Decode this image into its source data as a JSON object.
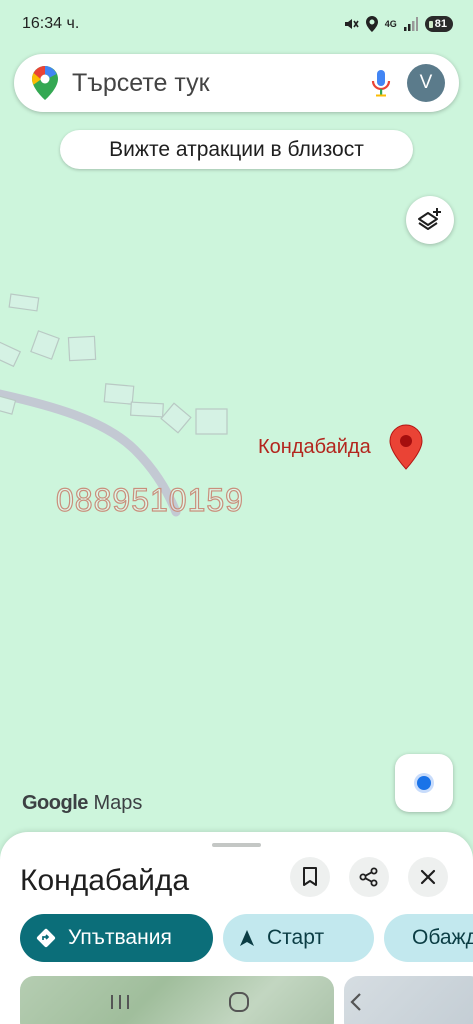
{
  "status_bar": {
    "time": "16:34 ч.",
    "network": "4G",
    "battery": "81"
  },
  "search": {
    "placeholder": "Търсете тук",
    "avatar_letter": "V"
  },
  "chips": {
    "attractions": "Вижте атракции в близост"
  },
  "map": {
    "place_label": "Кондабайда",
    "watermark": "0889510159",
    "logo_google": "Google",
    "logo_maps": "Maps"
  },
  "sheet": {
    "title": "Кондабайда",
    "actions": {
      "directions": "Упътвания",
      "start": "Старт",
      "call": "Обаждане"
    }
  },
  "colors": {
    "map_bg": "#cdf5dc",
    "accent": "#0b6e79",
    "secondary": "#c2e8ee",
    "pin": "#ea4335",
    "label": "#b3261e"
  }
}
